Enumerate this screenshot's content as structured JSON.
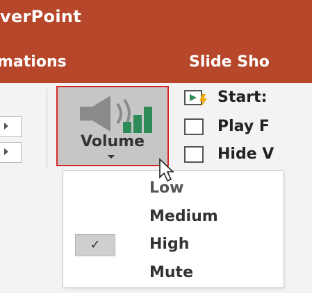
{
  "app": {
    "title_fragment": "verPoint"
  },
  "tabs": {
    "animations_fragment": "mations",
    "slideshow_fragment": "Slide Sho"
  },
  "ribbon": {
    "volume_label": "Volume",
    "options": {
      "start_label": "Start:",
      "play_label": "Play F",
      "hide_label": "Hide V"
    }
  },
  "volume_menu": {
    "items": [
      {
        "label": "Low",
        "checked": false
      },
      {
        "label": "Medium",
        "checked": false
      },
      {
        "label": "High",
        "checked": true
      },
      {
        "label": "Mute",
        "checked": false
      }
    ],
    "check_glyph": "✓"
  },
  "colors": {
    "title_bar": "#b7472a",
    "highlight_border": "#d62728",
    "speaker_bars": "#2e8b57"
  },
  "icons": [
    "speaker-volume-icon",
    "play-start-icon",
    "checkbox-icon",
    "mouse-pointer-icon",
    "chevron-down-icon"
  ]
}
